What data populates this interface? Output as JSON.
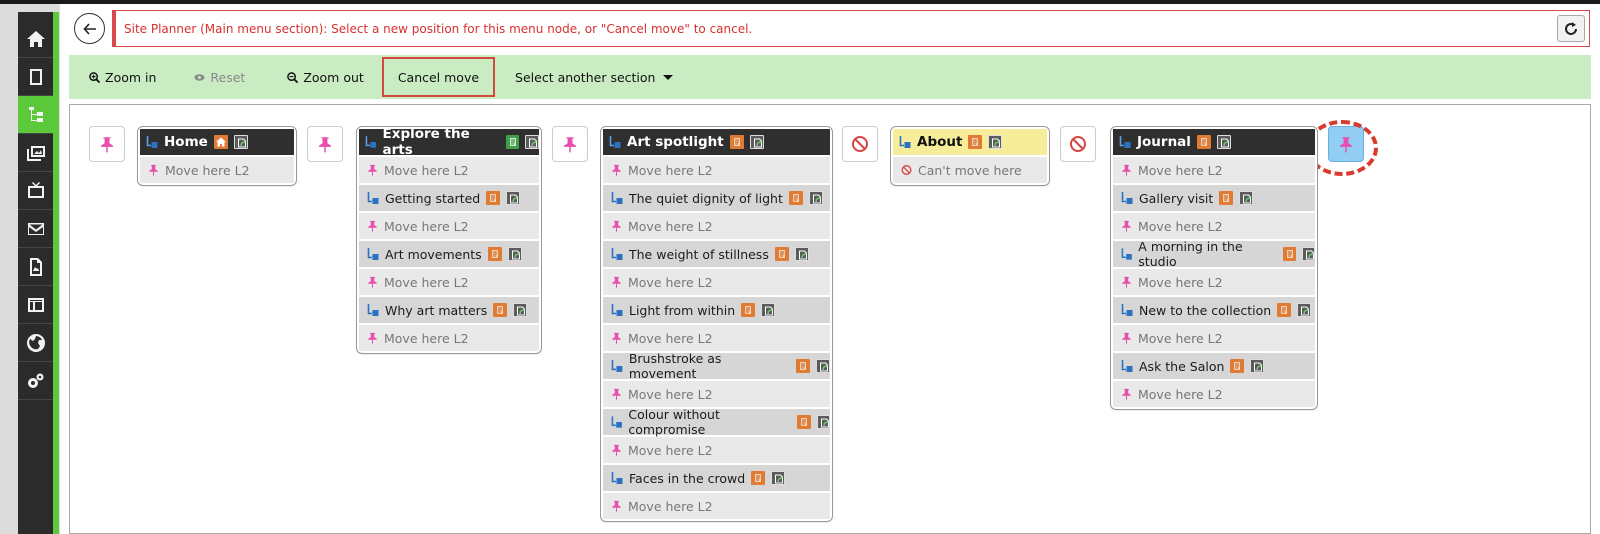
{
  "message": "Site Planner (Main menu section): Select a new position for this menu node, or \"Cancel move\" to cancel.",
  "toolbar": {
    "zoom_in": "Zoom in",
    "reset": "Reset",
    "zoom_out": "Zoom out",
    "cancel_move": "Cancel move",
    "select_section": "Select another section"
  },
  "slot_label": "Move here L2",
  "cant_move_label": "Can't move here",
  "columns": [
    {
      "title": "Home",
      "items": []
    },
    {
      "title": "Explore the arts",
      "items": [
        "Getting started",
        "Art movements",
        "Why art matters"
      ]
    },
    {
      "title": "Art spotlight",
      "items": [
        "The quiet dignity of light",
        "The weight of stillness",
        "Light from within",
        "Brushstroke as movement",
        "Colour without compromise",
        "Faces in the crowd"
      ]
    },
    {
      "title": "About",
      "items": []
    },
    {
      "title": "Journal",
      "items": [
        "Gallery visit",
        "A morning in the studio",
        "New to the collection",
        "Ask the Salon"
      ]
    }
  ],
  "colors": {
    "accent_green": "#5cc93a",
    "toolbar_bg": "#c9ecc3",
    "alert_red": "#d9302f",
    "pin_pink": "#e64fae",
    "drop_active": "#92cdf4",
    "highlight_yellow": "#f6ec9a"
  },
  "icons": {
    "sidebar": [
      "home-icon",
      "page-icon",
      "sitemap-icon",
      "gallery-icon",
      "media-icon",
      "mail-icon",
      "document-icon",
      "layout-icon",
      "globe-icon",
      "settings-icon"
    ]
  }
}
